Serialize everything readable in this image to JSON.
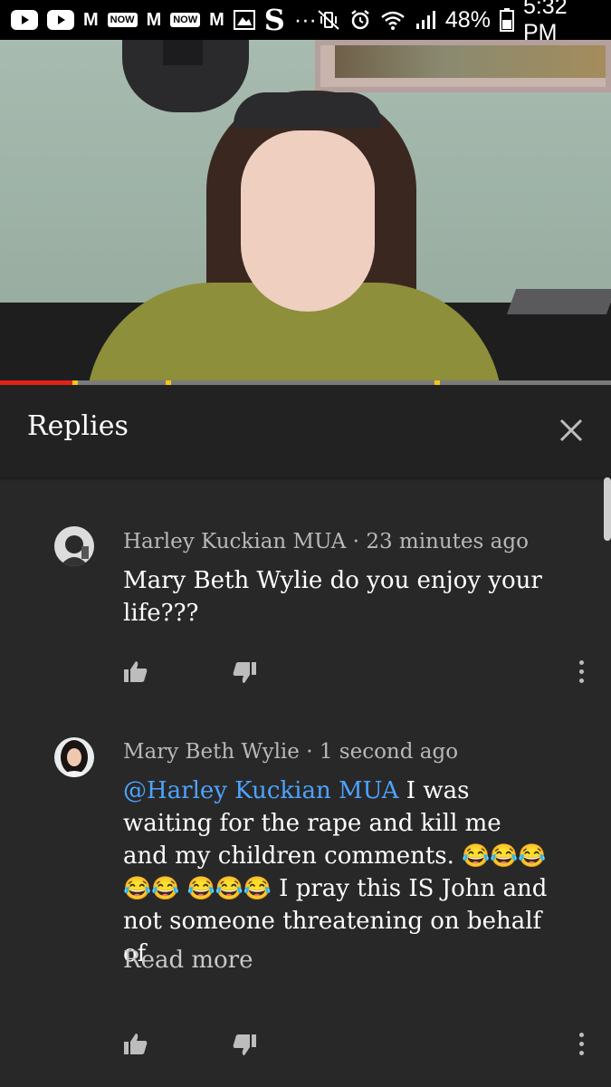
{
  "status_bar": {
    "battery": "48%",
    "time": "5:32 PM",
    "gmail_letter": "M",
    "now_label": "NOW",
    "app_letter": "S",
    "overflow_dots": "···"
  },
  "video": {
    "progress_fraction": 0.12
  },
  "panel": {
    "title": "Replies"
  },
  "comments": [
    {
      "author": "Harley Kuckian MUA",
      "separator": " · ",
      "time": "23 minutes ago",
      "text": "Mary Beth Wylie do you enjoy your life???"
    },
    {
      "author": "Mary Beth Wylie",
      "separator": " · ",
      "time": "1 second ago",
      "mention": "@Harley Kuckian MUA",
      "text_part1": " I was waiting for the rape and kill me and my children comments. ",
      "emojis_row1": "😂😂😂😂😂",
      "emojis_row2": "😂😂😂",
      "text_part2": " I pray this IS John and not someone threatening on behalf of",
      "read_more": "Read more"
    }
  ]
}
